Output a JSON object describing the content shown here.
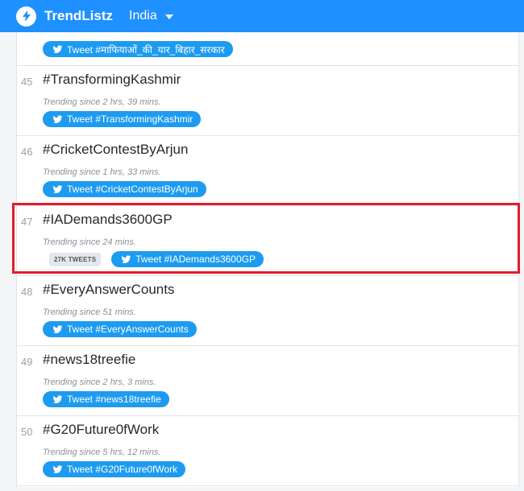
{
  "header": {
    "brand": "TrendListz",
    "country": "India"
  },
  "trends": [
    {
      "rank": "",
      "tag": "",
      "since": "",
      "tweet_label": "Tweet #माफियाओं_की_यार_बिहार_सरकार"
    },
    {
      "rank": "45",
      "tag": "#TransformingKashmir",
      "since": "Trending since 2 hrs, 39 mins.",
      "tweet_label": "Tweet #TransformingKashmir"
    },
    {
      "rank": "46",
      "tag": "#CricketContestByArjun",
      "since": "Trending since 1 hrs, 33 mins.",
      "tweet_label": "Tweet #CricketContestByArjun"
    },
    {
      "rank": "47",
      "tag": "#IADemands3600GP",
      "since": "Trending since 24 mins.",
      "tweet_count": "27K TWEETS",
      "tweet_label": "Tweet #IADemands3600GP"
    },
    {
      "rank": "48",
      "tag": "#EveryAnswerCounts",
      "since": "Trending since 51 mins.",
      "tweet_label": "Tweet #EveryAnswerCounts"
    },
    {
      "rank": "49",
      "tag": "#news18treefie",
      "since": "Trending since 2 hrs, 3 mins.",
      "tweet_label": "Tweet #news18treefie"
    },
    {
      "rank": "50",
      "tag": "#G20Future0fWork",
      "since": "Trending since 5 hrs, 12 mins.",
      "tweet_label": "Tweet #G20Future0fWork"
    }
  ],
  "colors": {
    "brand_blue": "#1e90ff",
    "tweet_blue": "#1d9bf0",
    "highlight_red": "#e11d2d"
  },
  "icons": [
    "lightning-icon",
    "caret-down-icon",
    "twitter-bird-icon"
  ]
}
